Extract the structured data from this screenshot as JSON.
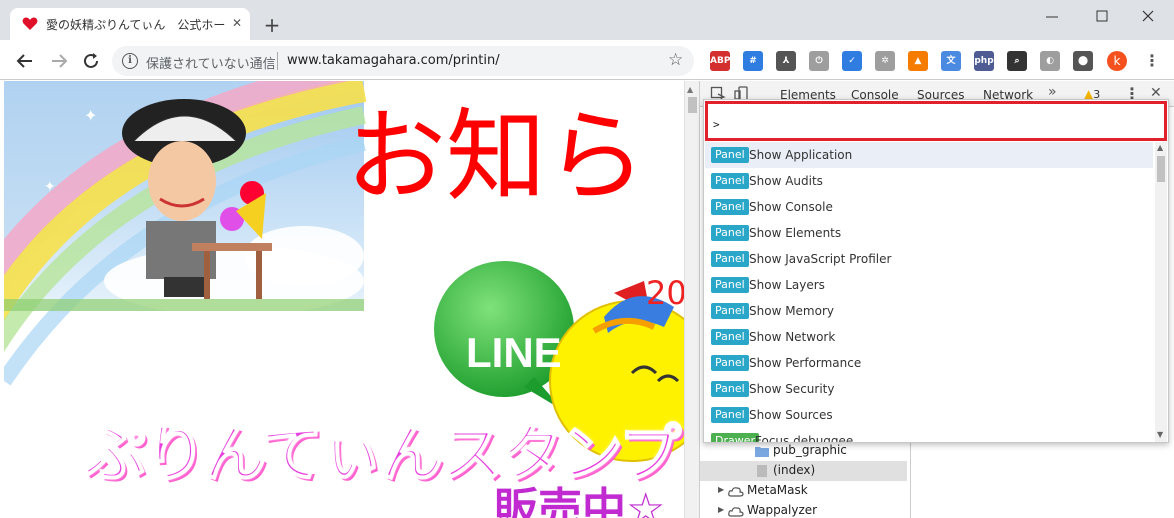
{
  "tab": {
    "title": "愛の妖精ぷりんてぃん　公式ホームペ",
    "close": "✕",
    "new_tab": "+"
  },
  "omnibox": {
    "security": "保護されていない通信",
    "url": "www.takamagahara.com/printin/",
    "info_glyph": "i",
    "star_glyph": "☆"
  },
  "extensions": [
    {
      "name": "abp-icon",
      "label": "ABP",
      "color": "#d32f2f"
    },
    {
      "name": "hashtag-icon",
      "label": "#",
      "color": "#2f7de1"
    },
    {
      "name": "compass-icon",
      "label": "⅄",
      "color": "#555555"
    },
    {
      "name": "power-icon",
      "label": "⏻",
      "color": "#9e9e9e"
    },
    {
      "name": "check-icon",
      "label": "✓",
      "color": "#2f7de1"
    },
    {
      "name": "puzzle-icon",
      "label": "✲",
      "color": "#9e9e9e"
    },
    {
      "name": "fox-icon",
      "label": "▲",
      "color": "#f57c00"
    },
    {
      "name": "translate-icon",
      "label": "文",
      "color": "#4a8ae0"
    },
    {
      "name": "php-icon",
      "label": "php",
      "color": "#4f5b93"
    },
    {
      "name": "magnifier-icon",
      "label": "⌕",
      "color": "#333333"
    },
    {
      "name": "wappalyzer-icon",
      "label": "◐",
      "color": "#9e9e9e"
    },
    {
      "name": "pin-icon",
      "label": "⬤",
      "color": "#555555"
    }
  ],
  "avatar_letter": "k",
  "menu_glyph": "⋮",
  "page": {
    "heading": "お知ら",
    "year": "20",
    "line": "LINE",
    "promo": "ぷりんてぃんスタンプ",
    "promo_tail": "販売中☆"
  },
  "devtools": {
    "tabs": [
      "Elements",
      "Console",
      "Sources",
      "Network"
    ],
    "more": "»",
    "warnings": "3",
    "warn_glyph": "▲",
    "dots": "⋮",
    "close": "✕",
    "tree": [
      {
        "label": "pub_graphic",
        "indent": 3,
        "icon": "folder"
      },
      {
        "label": "(index)",
        "indent": 3,
        "icon": "file",
        "selected": true
      },
      {
        "label": "MetaMask",
        "indent": 1,
        "icon": "cloud"
      },
      {
        "label": "Wappalyzer",
        "indent": 1,
        "icon": "cloud"
      }
    ]
  },
  "command_menu": {
    "input_value": ">",
    "items": [
      {
        "badge": "Panel",
        "label": "Show Application",
        "selected": true
      },
      {
        "badge": "Panel",
        "label": "Show Audits"
      },
      {
        "badge": "Panel",
        "label": "Show Console"
      },
      {
        "badge": "Panel",
        "label": "Show Elements"
      },
      {
        "badge": "Panel",
        "label": "Show JavaScript Profiler"
      },
      {
        "badge": "Panel",
        "label": "Show Layers"
      },
      {
        "badge": "Panel",
        "label": "Show Memory"
      },
      {
        "badge": "Panel",
        "label": "Show Network"
      },
      {
        "badge": "Panel",
        "label": "Show Performance"
      },
      {
        "badge": "Panel",
        "label": "Show Security"
      },
      {
        "badge": "Panel",
        "label": "Show Sources"
      },
      {
        "badge": "Drawer",
        "label": "Focus debuggee"
      }
    ]
  }
}
